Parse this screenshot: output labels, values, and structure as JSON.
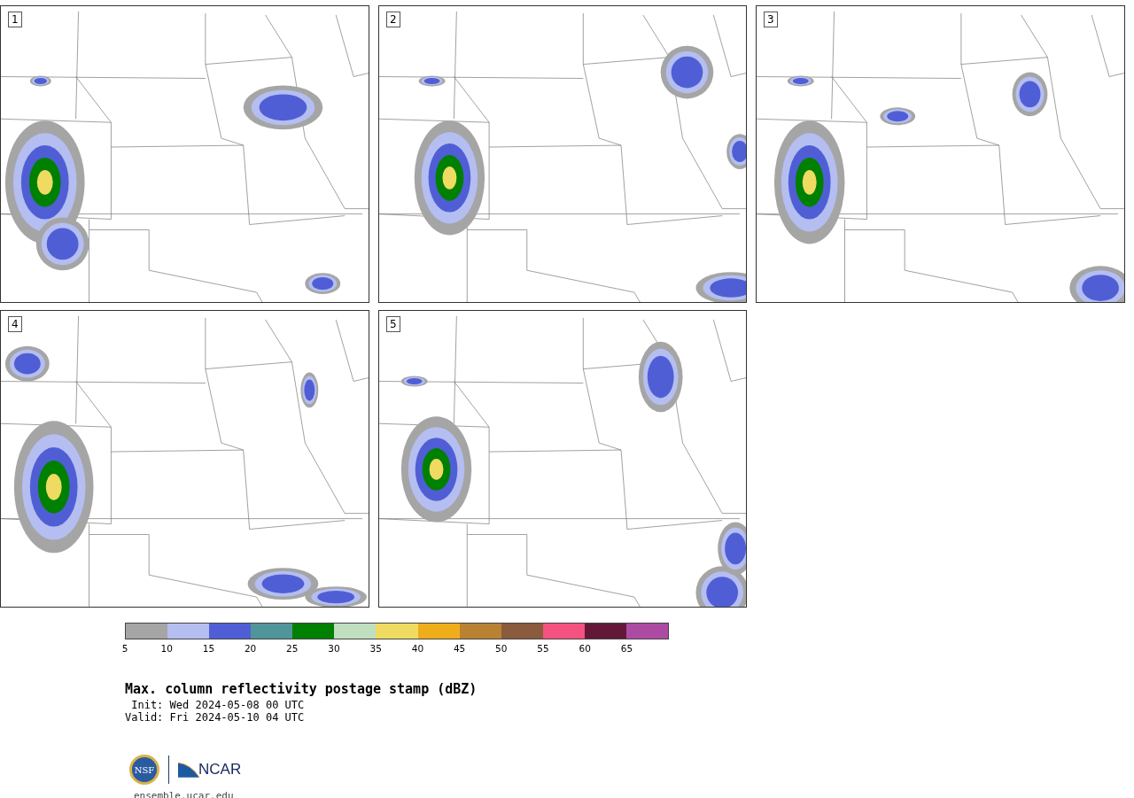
{
  "panels": [
    {
      "label": "1"
    },
    {
      "label": "2"
    },
    {
      "label": "3"
    },
    {
      "label": "4"
    },
    {
      "label": "5"
    }
  ],
  "colorbar": {
    "segments": [
      {
        "color": "#a5a5a5"
      },
      {
        "color": "#b4bef0"
      },
      {
        "color": "#505ed6"
      },
      {
        "color": "#4f9599"
      },
      {
        "color": "#008000"
      },
      {
        "color": "#bfdfbf"
      },
      {
        "color": "#efdb61"
      },
      {
        "color": "#efad19"
      },
      {
        "color": "#b98232"
      },
      {
        "color": "#8a5b3d"
      },
      {
        "color": "#f45280"
      },
      {
        "color": "#631838"
      },
      {
        "color": "#ad4ba2"
      }
    ],
    "ticks": [
      "5",
      "10",
      "15",
      "20",
      "25",
      "30",
      "35",
      "40",
      "45",
      "50",
      "55",
      "60",
      "65"
    ]
  },
  "title": "Max. column reflectivity postage stamp (dBZ)",
  "init": "Init: Wed 2024-05-08 00 UTC",
  "valid": "Valid: Fri 2024-05-10 04 UTC",
  "logos": {
    "emblem": "NSF",
    "name": "NCAR"
  },
  "site": "ensemble.ucar.edu"
}
